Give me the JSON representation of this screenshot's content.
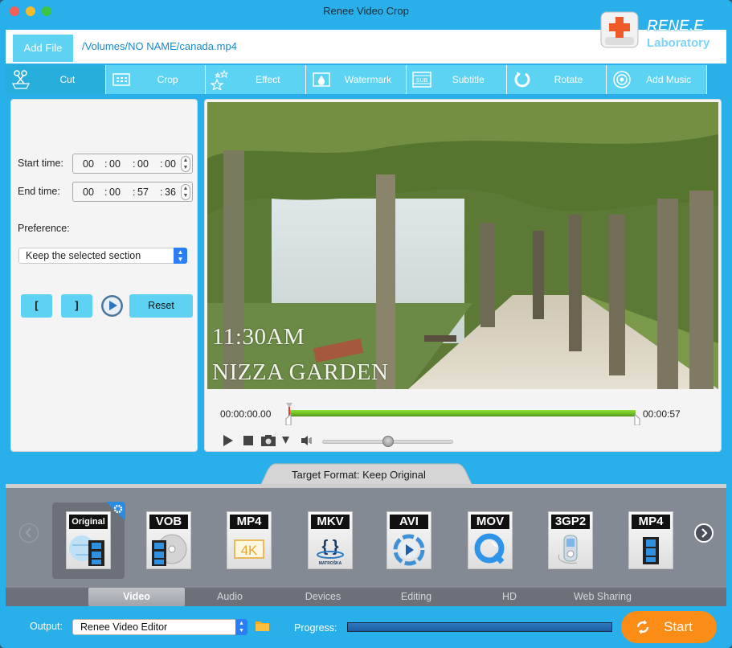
{
  "window": {
    "title": "Renee Video Crop"
  },
  "header": {
    "add_file_label": "Add File",
    "file_path": "/Volumes/NO NAME/canada.mp4",
    "logo": {
      "brand": "RENE.E",
      "sub": "Laboratory"
    }
  },
  "tabs": [
    {
      "label": "Cut",
      "icon": "scissors-icon",
      "active": true
    },
    {
      "label": "Crop",
      "icon": "crop-icon",
      "active": false
    },
    {
      "label": "Effect",
      "icon": "stars-icon",
      "active": false
    },
    {
      "label": "Watermark",
      "icon": "watermark-icon",
      "active": false
    },
    {
      "label": "Subtitle",
      "icon": "subtitle-icon",
      "active": false
    },
    {
      "label": "Rotate",
      "icon": "rotate-icon",
      "active": false
    },
    {
      "label": "Add Music",
      "icon": "music-icon",
      "active": false
    }
  ],
  "cut_panel": {
    "start_label": "Start time:",
    "start_time": [
      "00",
      "00",
      "00",
      "00"
    ],
    "end_label": "End time:",
    "end_time": [
      "00",
      "00",
      "57",
      "36"
    ],
    "separator": ":",
    "preference_label": "Preference:",
    "preference_value": "Keep the selected section",
    "mark_in_label": "[",
    "mark_out_label": "]",
    "reset_label": "Reset"
  },
  "player": {
    "overlay_line1": "11:30AM",
    "overlay_line2": "NIZZA GARDEN",
    "current_time": "00:00:00.00",
    "end_time": "00:00:57",
    "volume": 0.5
  },
  "format": {
    "target_label": "Target Format: Keep Original",
    "items": [
      {
        "label": "Original",
        "selected": true
      },
      {
        "label": "VOB"
      },
      {
        "label": "MP4",
        "badge": "4K"
      },
      {
        "label": "MKV",
        "badge": "MATROŠKA"
      },
      {
        "label": "AVI"
      },
      {
        "label": "MOV"
      },
      {
        "label": "3GP2"
      },
      {
        "label": "MP4"
      }
    ],
    "categories": [
      {
        "label": "Video",
        "active": true
      },
      {
        "label": "Audio"
      },
      {
        "label": "Devices"
      },
      {
        "label": "Editing"
      },
      {
        "label": "HD"
      },
      {
        "label": "Web Sharing"
      }
    ]
  },
  "footer": {
    "output_label": "Output:",
    "output_value": "Renee Video Editor",
    "progress_label": "Progress:",
    "start_label": "Start"
  },
  "colors": {
    "accent": "#29b0ea",
    "tab": "#5cd3f3",
    "start": "#fb8c16",
    "timeline": "#7ccf2c"
  }
}
